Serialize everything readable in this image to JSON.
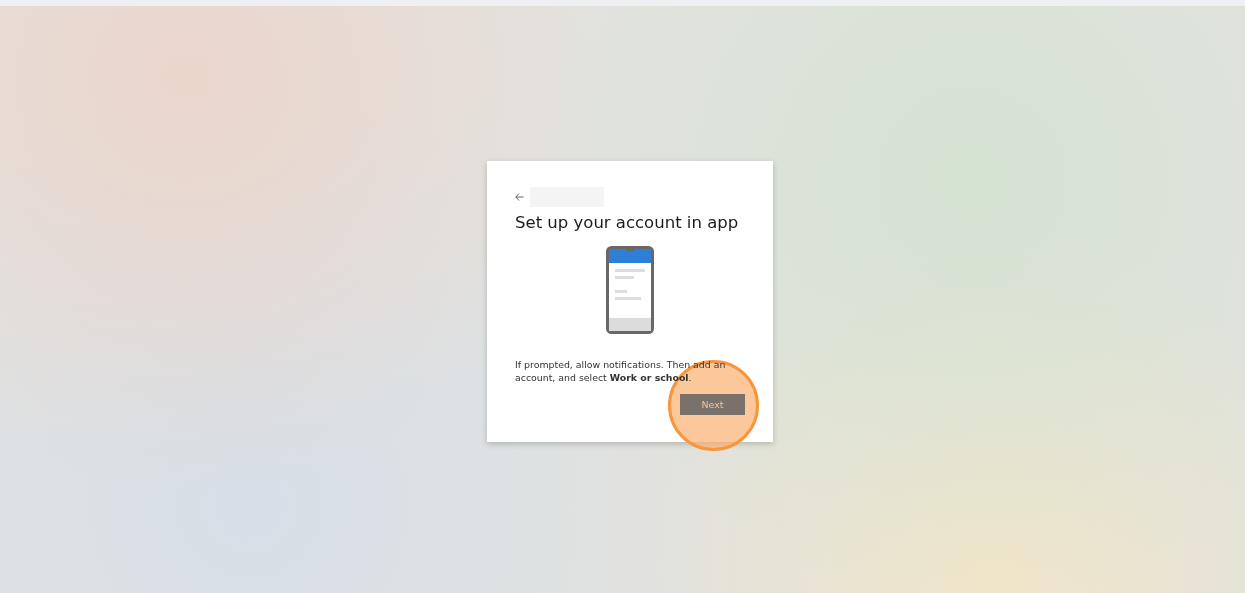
{
  "card": {
    "title": "Set up your account in app",
    "instructions": "If prompted, allow notifications. Then add an account, and select **Work or school**.",
    "next_button": {
      "label": "Next",
      "highlighted": true
    }
  }
}
